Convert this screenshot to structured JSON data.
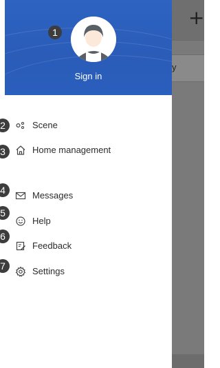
{
  "header": {
    "signin_label": "Sign in",
    "colors": {
      "background": "#2e63c2",
      "text": "#ffffff"
    }
  },
  "menu": [
    {
      "label": "Scene",
      "icon": "scene-icon"
    },
    {
      "label": "Home management",
      "icon": "home-icon"
    },
    {
      "label": "Messages",
      "icon": "envelope-icon"
    },
    {
      "label": "Help",
      "icon": "smiley-icon"
    },
    {
      "label": "Feedback",
      "icon": "edit-icon"
    },
    {
      "label": "Settings",
      "icon": "gear-icon"
    }
  ],
  "badges": [
    "1",
    "2",
    "3",
    "4",
    "5",
    "6",
    "7"
  ],
  "background_app": {
    "add_glyph": "+",
    "row_text_fragment": "y"
  }
}
